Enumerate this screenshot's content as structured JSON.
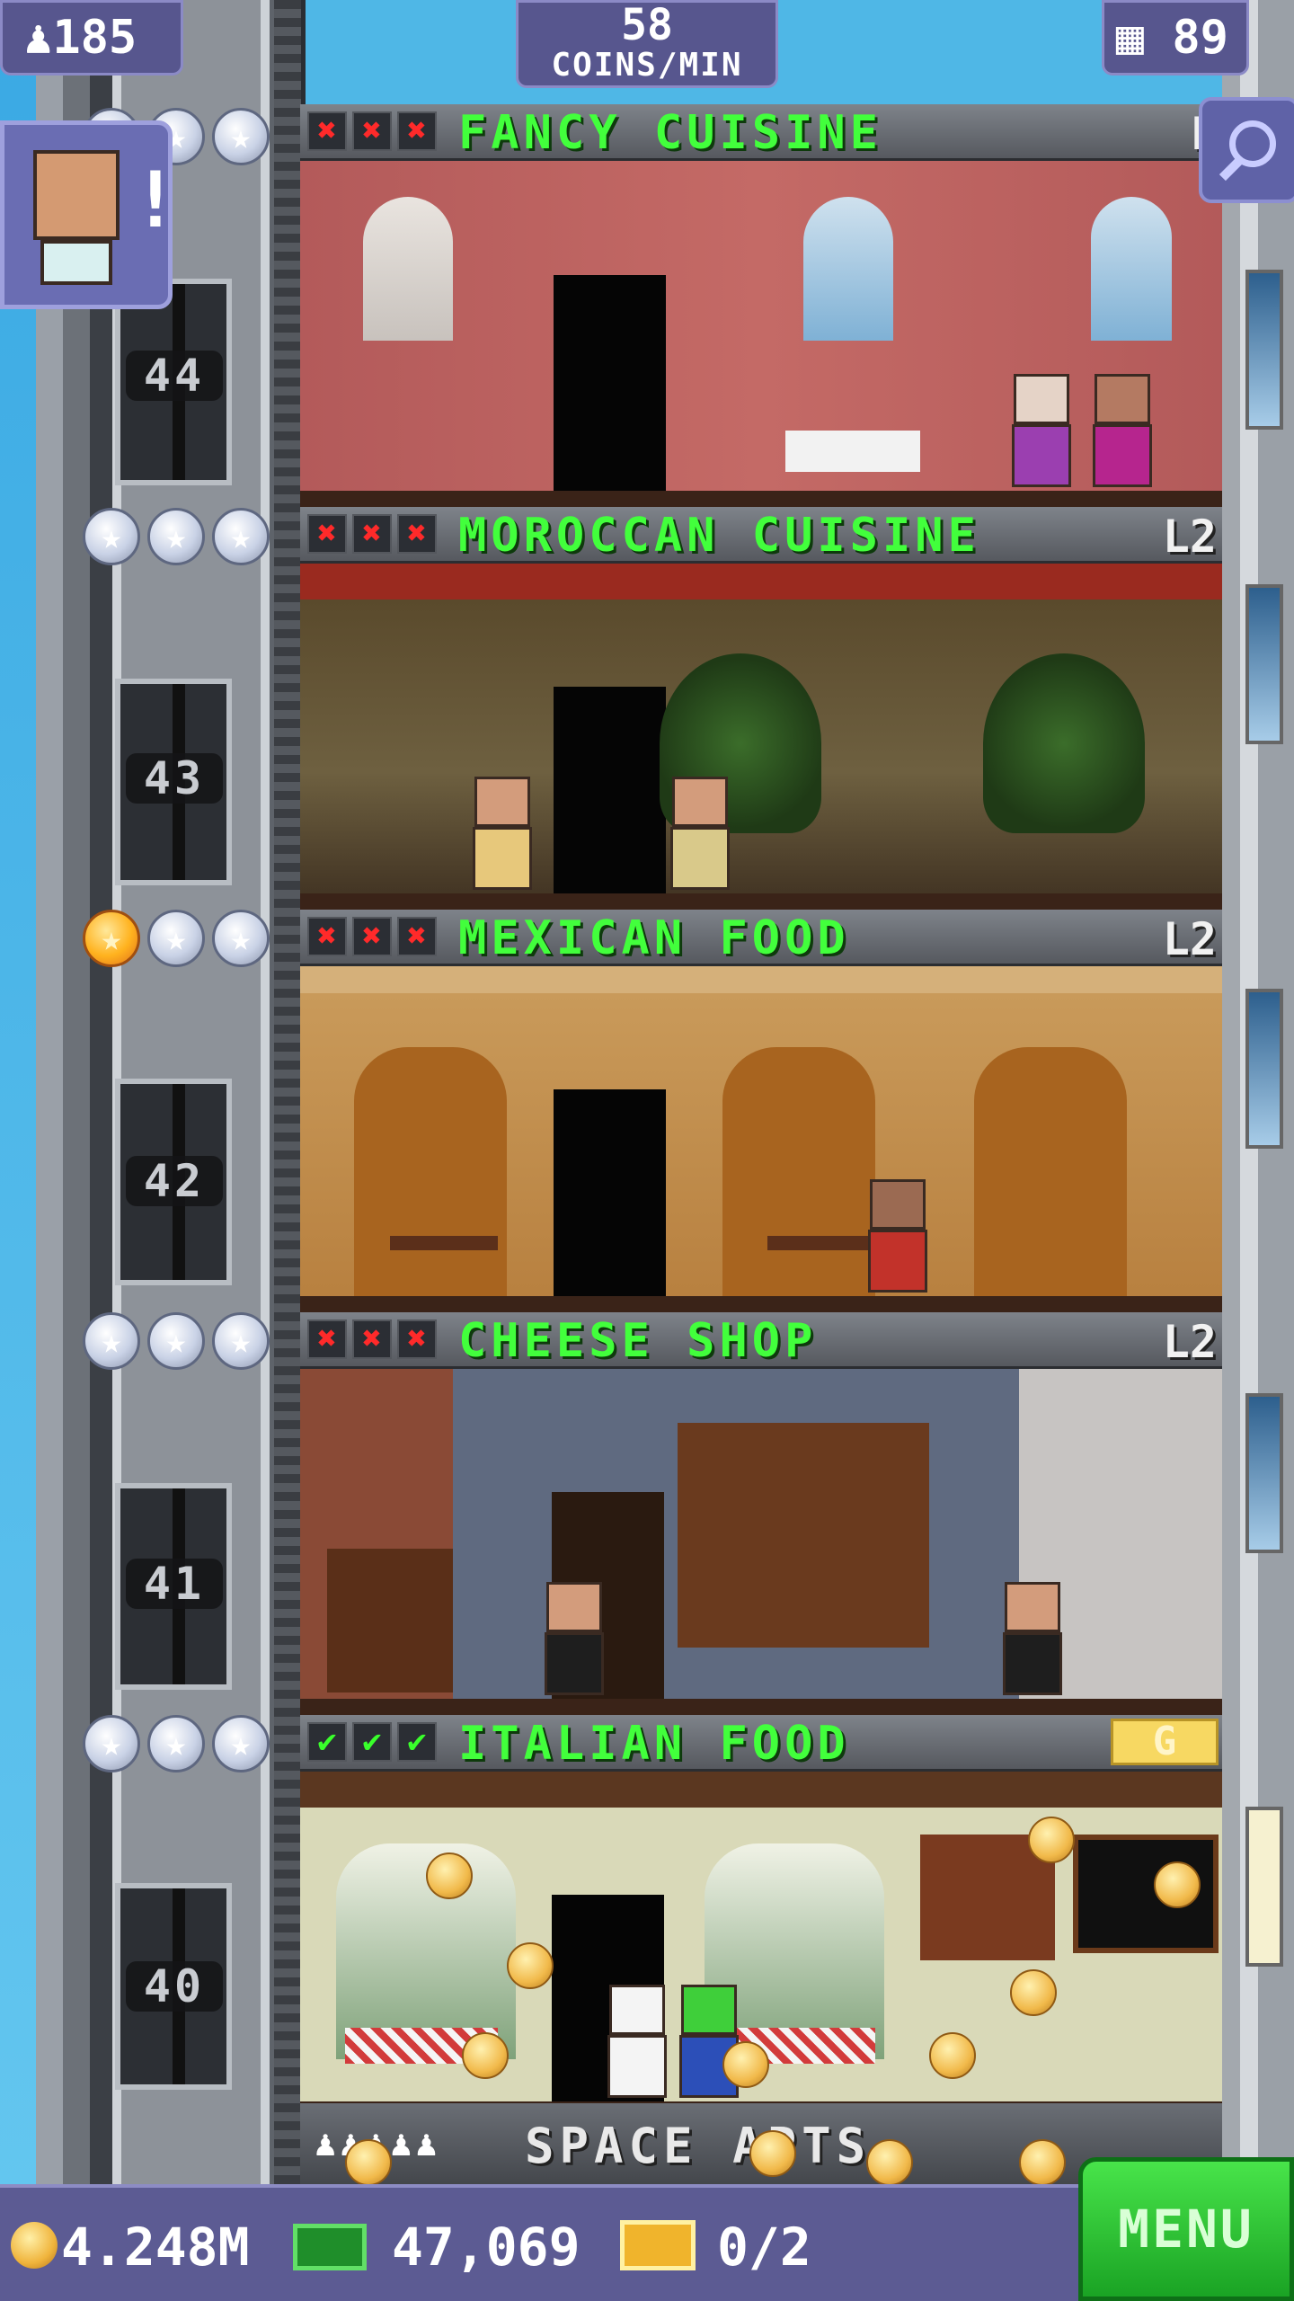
{
  "hud": {
    "population": "185",
    "coin_rate_value": "58",
    "coin_rate_unit": "COINS/MIN",
    "floor_count": "89"
  },
  "floors": [
    {
      "number": "44",
      "name": "FANCY CUISINE",
      "level": "L",
      "stars": [
        false,
        false,
        false
      ],
      "marks": [
        "x",
        "x",
        "x"
      ]
    },
    {
      "number": "43",
      "name": "MOROCCAN CUISINE",
      "level": "L2",
      "stars": [
        false,
        false,
        false
      ],
      "marks": [
        "x",
        "x",
        "x"
      ]
    },
    {
      "number": "42",
      "name": "MEXICAN FOOD",
      "level": "L2",
      "stars": [
        true,
        false,
        false
      ],
      "marks": [
        "x",
        "x",
        "x"
      ]
    },
    {
      "number": "41",
      "name": "CHEESE SHOP",
      "level": "L2",
      "stars": [
        false,
        false,
        false
      ],
      "marks": [
        "x",
        "x",
        "x"
      ]
    },
    {
      "number": "40",
      "name": "ITALIAN FOOD",
      "level": "G",
      "stars": [
        false,
        false,
        false
      ],
      "marks": [
        "ok",
        "ok",
        "ok"
      ]
    }
  ],
  "apartments": {
    "label": "SPACE APTS.",
    "residents": "♟♟♟♟♟"
  },
  "bottom_bar": {
    "coins": "4.248M",
    "bux": "47,069",
    "vip": "0/2",
    "menu_label": "MENU"
  },
  "colors": {
    "hud_bg": "#57568e",
    "floor_name_green": "#42ff3c",
    "menu_green": "#2fcc35",
    "star_gold": "#ffb21e"
  },
  "icons": [
    "population-icon",
    "floors-icon",
    "zoom-icon",
    "coin-icon",
    "bux-icon",
    "vip-ticket-icon",
    "star-icon",
    "close-mark-icon",
    "check-mark-icon"
  ]
}
